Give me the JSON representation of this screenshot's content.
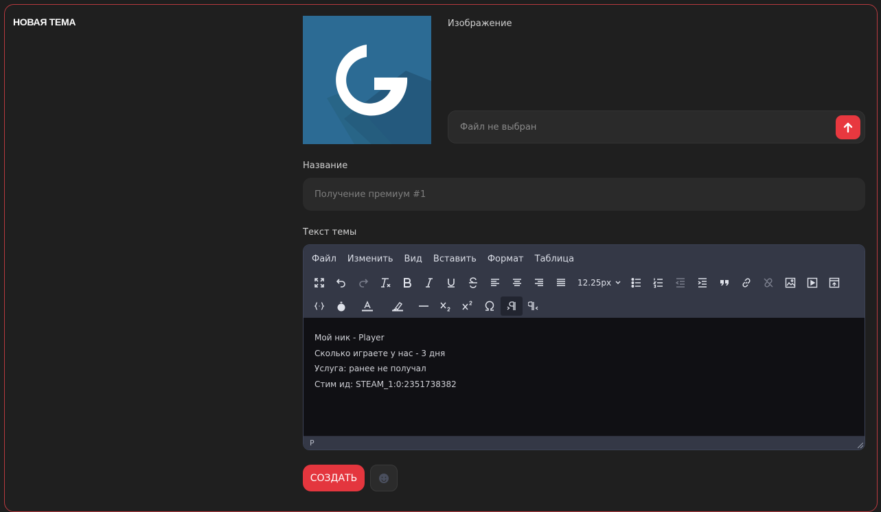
{
  "section": {
    "title": "НОВАЯ ТЕМА"
  },
  "image_field": {
    "label": "Изображение",
    "file_status": "Файл не выбран"
  },
  "name_field": {
    "label": "Название",
    "placeholder": "Получение премиум #1"
  },
  "body_field": {
    "label": "Текст темы"
  },
  "editor": {
    "menu": [
      "Файл",
      "Изменить",
      "Вид",
      "Вставить",
      "Формат",
      "Таблица"
    ],
    "font_size": "12.25px",
    "content_lines": [
      "Мой ник - Player",
      "Сколько играете у нас - 3 дня",
      "Услуга: ранее не получал",
      "Стим ид: STEAM_1:0:2351738382"
    ],
    "status_path": "P"
  },
  "actions": {
    "create_label": "СОЗДАТЬ"
  },
  "colors": {
    "accent": "#e4363e",
    "logo_bg": "#2c6b94",
    "editor_toolbar": "#343846"
  }
}
